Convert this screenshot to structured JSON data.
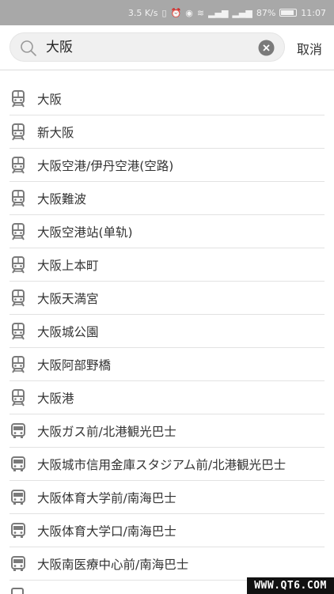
{
  "status_bar": {
    "speed": "3.5 K/s",
    "battery_percent": "87%",
    "time": "11:07"
  },
  "search": {
    "query": "大阪",
    "cancel_label": "取消"
  },
  "results": [
    {
      "label": "大阪",
      "icon": "train-icon"
    },
    {
      "label": "新大阪",
      "icon": "train-icon"
    },
    {
      "label": "大阪空港/伊丹空港(空路)",
      "icon": "train-icon"
    },
    {
      "label": "大阪難波",
      "icon": "train-icon"
    },
    {
      "label": "大阪空港站(单轨)",
      "icon": "train-icon"
    },
    {
      "label": "大阪上本町",
      "icon": "train-icon"
    },
    {
      "label": "大阪天満宮",
      "icon": "train-icon"
    },
    {
      "label": "大阪城公園",
      "icon": "train-icon"
    },
    {
      "label": "大阪阿部野橋",
      "icon": "train-icon"
    },
    {
      "label": "大阪港",
      "icon": "train-icon"
    },
    {
      "label": "大阪ガス前/北港観光巴士",
      "icon": "bus-icon"
    },
    {
      "label": "大阪城市信用金庫スタジアム前/北港観光巴士",
      "icon": "bus-icon"
    },
    {
      "label": "大阪体育大学前/南海巴士",
      "icon": "bus-icon"
    },
    {
      "label": "大阪体育大学口/南海巴士",
      "icon": "bus-icon"
    },
    {
      "label": "大阪南医療中心前/南海巴士",
      "icon": "bus-icon"
    }
  ],
  "watermark": "WWW.QT6.COM"
}
